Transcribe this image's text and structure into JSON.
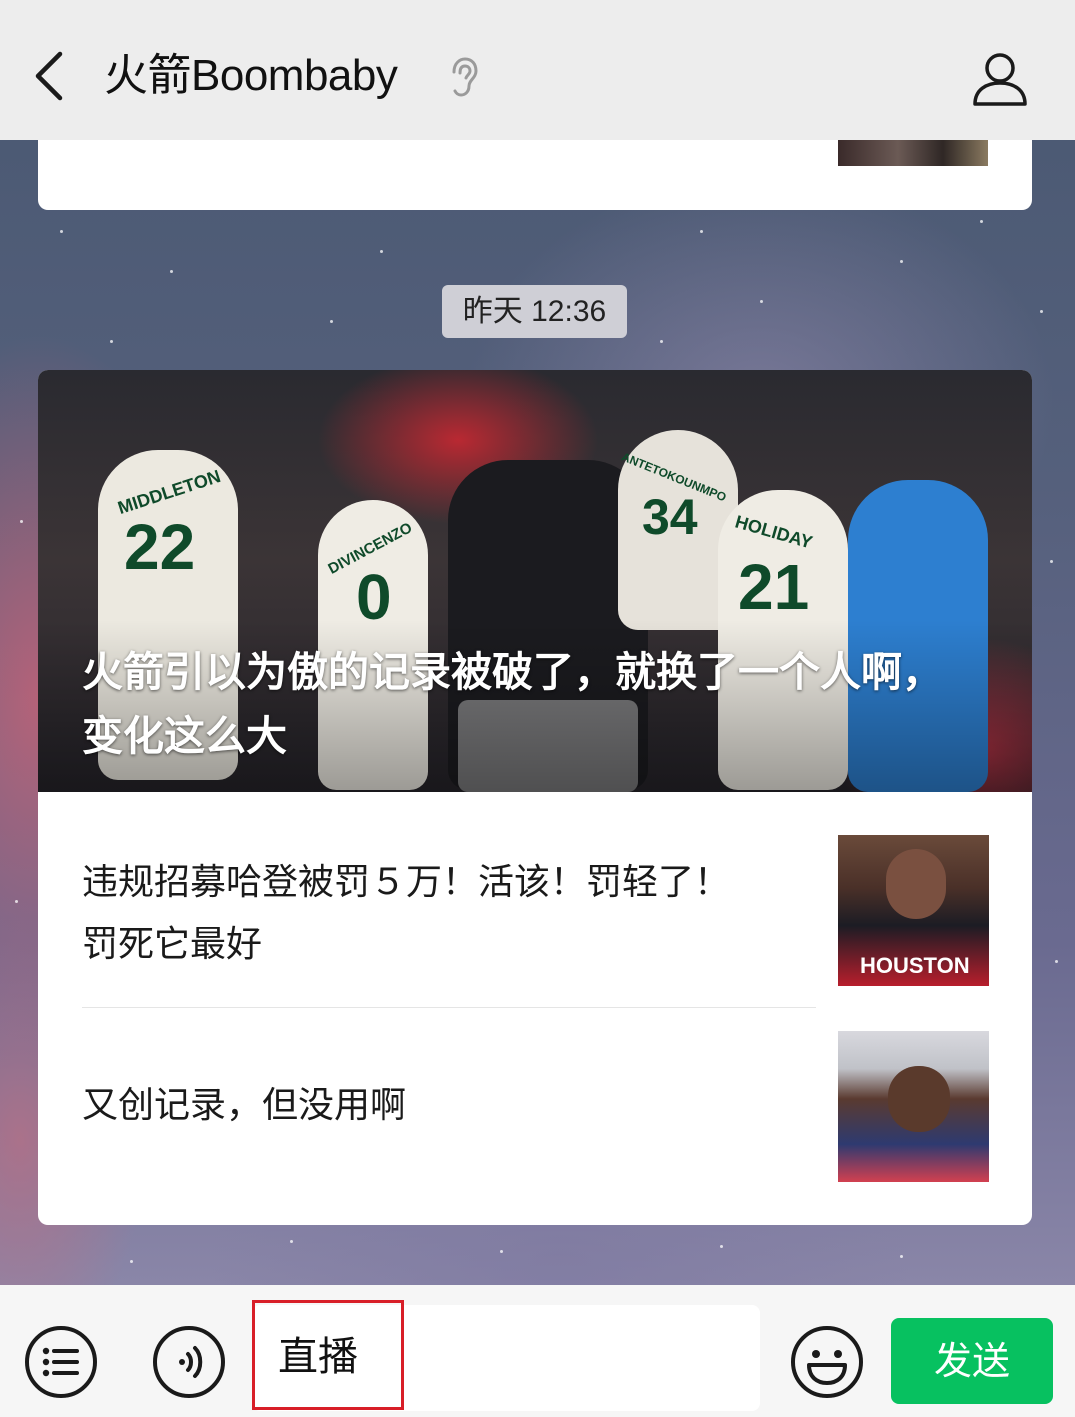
{
  "header": {
    "title": "火箭Boombaby"
  },
  "timestamp": "昨天 12:36",
  "article": {
    "headline": "火箭引以为傲的记录被破了，就换了一个人啊，变化这么大",
    "hero_jerseys": [
      {
        "name": "MIDDLETON",
        "number": "22"
      },
      {
        "name": "DIVINCENZO",
        "number": "0"
      },
      {
        "name": "ANTETOKOUNMPO",
        "number": "34"
      },
      {
        "name": "HOLIDAY",
        "number": "21"
      }
    ],
    "items": [
      {
        "text": "违规招募哈登被罚５万！活该！罚轻了！罚死它最好",
        "thumb_caption": "HOUSTON"
      },
      {
        "text": "又创记录，但没用啊"
      }
    ]
  },
  "input": {
    "value": "直播"
  },
  "send_label": "发送",
  "colors": {
    "send_button": "#07c160",
    "highlight_box": "#d81e28",
    "topbar": "#ededed"
  }
}
